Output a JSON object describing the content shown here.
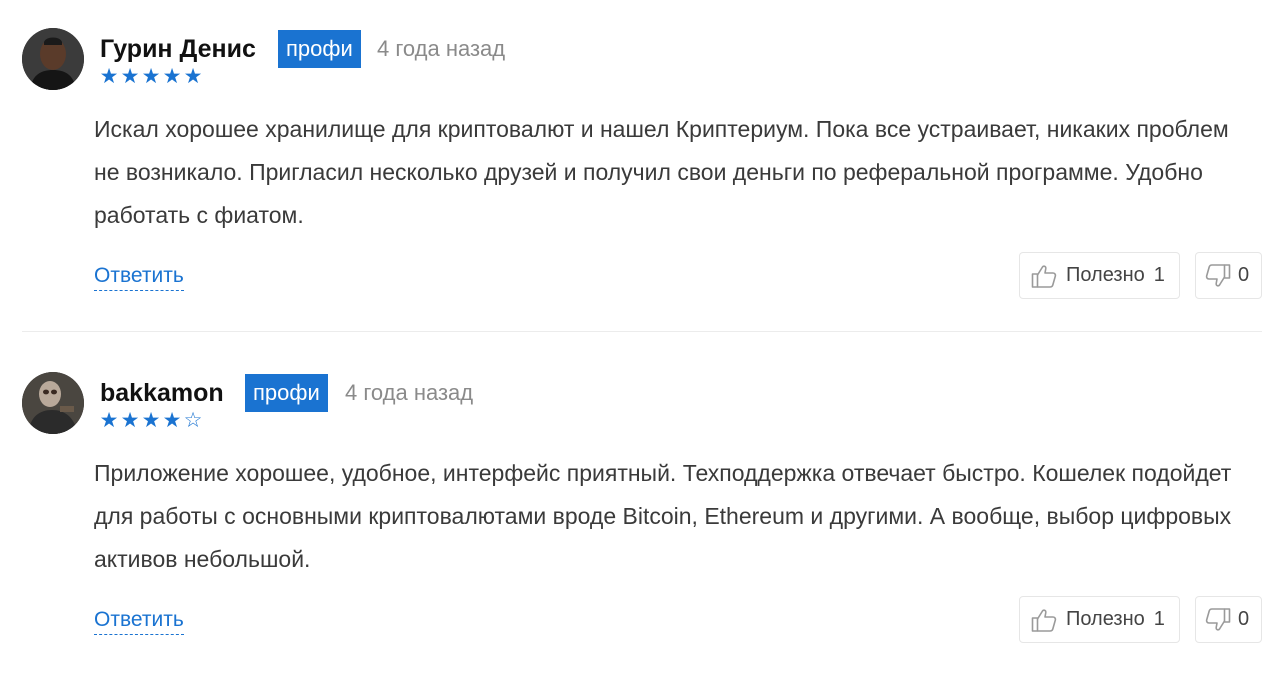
{
  "reviews": [
    {
      "author": "Гурин Денис",
      "badge": "профи",
      "date": "4 года назад",
      "rating": 5,
      "stars": [
        "★",
        "★",
        "★",
        "★",
        "★"
      ],
      "text": "Искал хорошее хранилище для криптовалют и нашел Криптериум. Пока все устраивает, никаких проблем не возникало. Пригласил несколько друзей и получил свои деньги по реферальной программе. Удобно работать с фиатом.",
      "reply_label": "Ответить",
      "useful_label": "Полезно",
      "useful_count": "1",
      "dislike_count": "0"
    },
    {
      "author": "bakkamon",
      "badge": "профи",
      "date": "4 года назад",
      "rating": 4,
      "stars": [
        "★",
        "★",
        "★",
        "★",
        "☆"
      ],
      "text": "Приложение хорошее, удобное, интерфейс приятный. Техподдержка отвечает быстро. Кошелек подойдет для работы с основными криптовалютами вроде Bitcoin, Ethereum и другими. А вообще, выбор цифровых активов небольшой.",
      "reply_label": "Ответить",
      "useful_label": "Полезно",
      "useful_count": "1",
      "dislike_count": "0"
    }
  ],
  "colors": {
    "accent": "#1a73d1",
    "badge_bg": "#1a73d1",
    "date": "#8a8a8a",
    "text": "#3a3a3a"
  },
  "icons": {
    "like": "thumbs-up-icon",
    "dislike": "thumbs-down-icon",
    "star": "star-icon"
  }
}
